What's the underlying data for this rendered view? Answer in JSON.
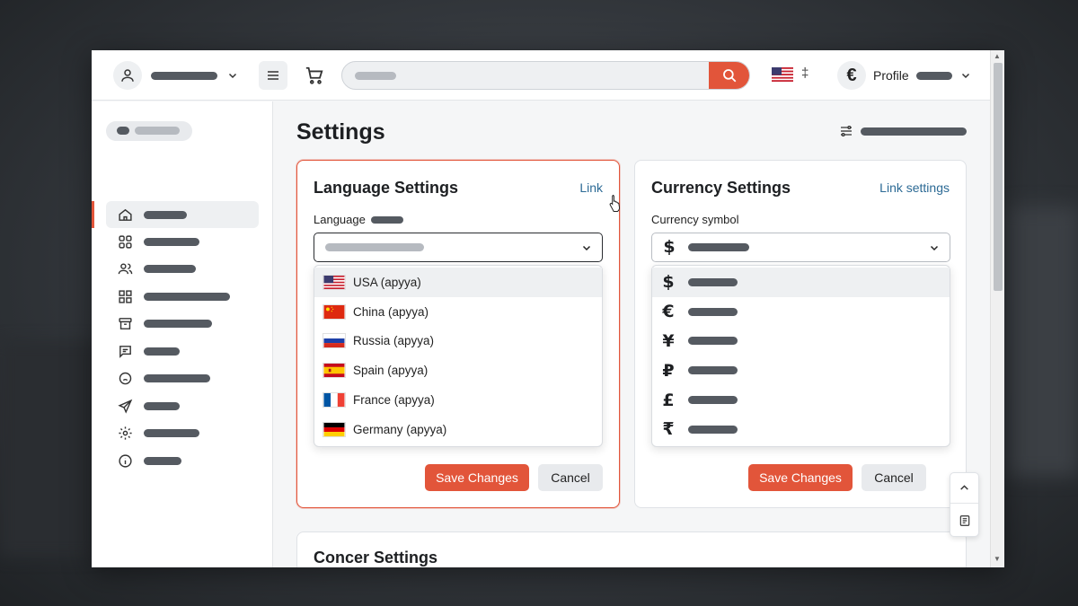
{
  "main": {
    "page_title": "Settings",
    "language_card": {
      "title": "Language Settings",
      "link": "Link",
      "field_label": "Language",
      "options": [
        {
          "label": "USA (apyya)",
          "flag": "us-flag-icon"
        },
        {
          "label": "China (apyya)",
          "flag": "china-flag-icon"
        },
        {
          "label": "Russia (apyya)",
          "flag": "russia-flag-icon"
        },
        {
          "label": "Spain (apyya)",
          "flag": "spain-flag-icon"
        },
        {
          "label": "France (apyya)",
          "flag": "france-flag-icon"
        },
        {
          "label": "Germany (apyya)",
          "flag": "germany-flag-icon"
        }
      ],
      "save_label": "Save Changes",
      "cancel_label": "Cancel"
    },
    "currency_card": {
      "title": "Currency Settings",
      "link": "Link settings",
      "field_label": "Currency symbol",
      "selected_symbol": "$",
      "options": [
        {
          "symbol": "$"
        },
        {
          "symbol": "€"
        },
        {
          "symbol": "¥"
        },
        {
          "symbol": "₽"
        },
        {
          "symbol": "£"
        },
        {
          "symbol": "₹"
        }
      ],
      "save_label": "Save Changes",
      "cancel_label": "Cancel"
    },
    "third_card": {
      "title": "Concer Settings"
    }
  },
  "header": {
    "profile_label": "Profile",
    "profile_currency": "€",
    "flag_separator": "‡"
  },
  "colors": {
    "accent": "#e2553a",
    "link": "#2c6a95"
  }
}
